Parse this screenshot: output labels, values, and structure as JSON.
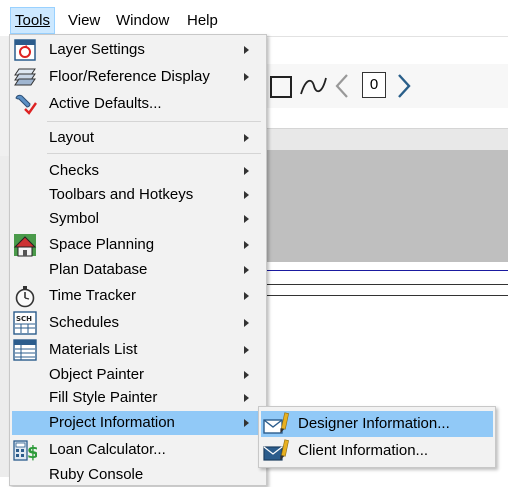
{
  "menubar": {
    "tools": "Tools",
    "view": "View",
    "window": "Window",
    "help": "Help"
  },
  "toolbar": {
    "counter": "0"
  },
  "tools_menu": {
    "items": [
      {
        "label": "Layer Settings",
        "submenu": true,
        "icon": "layer-settings-icon"
      },
      {
        "label": "Floor/Reference Display",
        "submenu": true,
        "icon": "floor-display-icon"
      },
      {
        "label": "Active Defaults...",
        "submenu": false,
        "icon": "active-defaults-icon"
      },
      {
        "label": "Layout",
        "submenu": true,
        "icon": ""
      },
      {
        "label": "Checks",
        "submenu": true,
        "icon": ""
      },
      {
        "label": "Toolbars and Hotkeys",
        "submenu": true,
        "icon": ""
      },
      {
        "label": "Symbol",
        "submenu": true,
        "icon": ""
      },
      {
        "label": "Space Planning",
        "submenu": true,
        "icon": "space-planning-icon"
      },
      {
        "label": "Plan Database",
        "submenu": true,
        "icon": ""
      },
      {
        "label": "Time Tracker",
        "submenu": true,
        "icon": "stopwatch-icon"
      },
      {
        "label": "Schedules",
        "submenu": true,
        "icon": "schedule-icon"
      },
      {
        "label": "Materials List",
        "submenu": true,
        "icon": "materials-list-icon"
      },
      {
        "label": "Object Painter",
        "submenu": true,
        "icon": ""
      },
      {
        "label": "Fill Style Painter",
        "submenu": true,
        "icon": ""
      },
      {
        "label": "Project Information",
        "submenu": true,
        "icon": "",
        "highlighted": true
      },
      {
        "label": "Loan Calculator...",
        "submenu": false,
        "icon": "loan-calculator-icon"
      },
      {
        "label": "Ruby Console",
        "submenu": false,
        "icon": ""
      }
    ]
  },
  "project_info_submenu": {
    "items": [
      {
        "label": "Designer Information...",
        "icon": "designer-info-icon",
        "highlighted": true
      },
      {
        "label": "Client Information...",
        "icon": "client-info-icon"
      }
    ]
  },
  "colors": {
    "highlight": "#91c9f7",
    "menu_background": "#f2f2f2",
    "active_menubar": "#cce8ff"
  }
}
